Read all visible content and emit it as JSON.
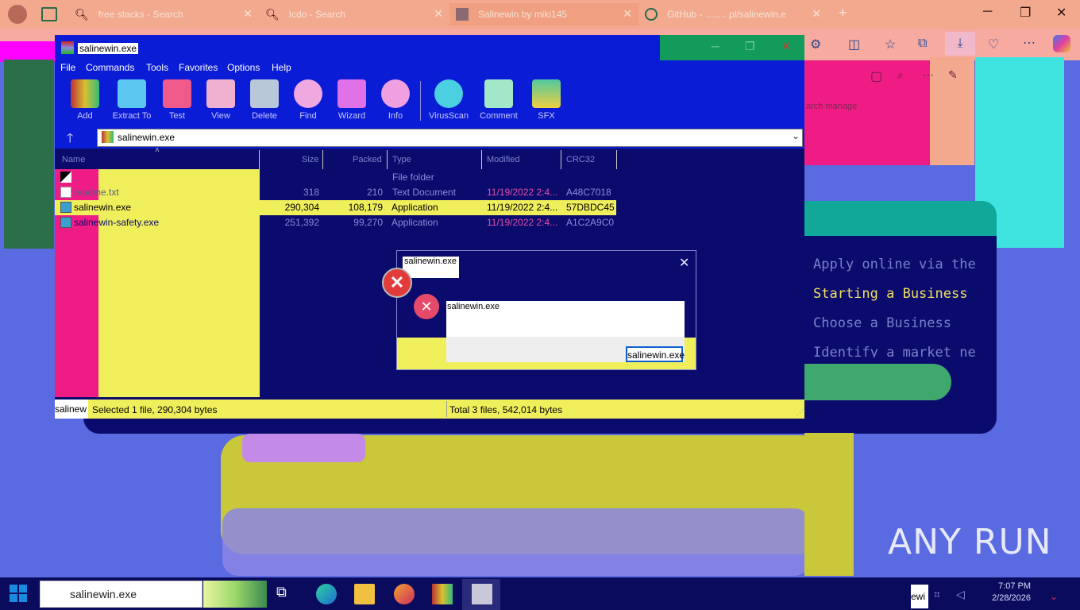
{
  "browser": {
    "tabs": [
      {
        "label": "free stacks - Search"
      },
      {
        "label": "Icdo - Search"
      },
      {
        "label": "Salinewin by miki145"
      },
      {
        "label": "GitHub - ........ pl/salinewin.e"
      }
    ]
  },
  "winrar": {
    "title": "salinewin.exe",
    "menu": [
      "File",
      "Commands",
      "Tools",
      "Favorites",
      "Options",
      "Help"
    ],
    "toolbar": [
      "Add",
      "Extract To",
      "Test",
      "View",
      "Delete",
      "Find",
      "Wizard",
      "Info",
      "VirusScan",
      "Comment",
      "SFX"
    ],
    "path": "salinewin.exe",
    "columns": [
      "Name",
      "Size",
      "Packed",
      "Type",
      "Modified",
      "CRC32"
    ],
    "files": [
      {
        "name": "..",
        "size": "",
        "packed": "",
        "type": "File folder",
        "modified": "",
        "crc": ""
      },
      {
        "name": "readme.txt",
        "size": "318",
        "packed": "210",
        "type": "Text Document",
        "modified": "11/19/2022 2:4...",
        "crc": "A48C7018"
      },
      {
        "name": "salinewin.exe",
        "size": "290,304",
        "packed": "108,179",
        "type": "Application",
        "modified": "11/19/2022 2:4...",
        "crc": "57DBDC45"
      },
      {
        "name": "salinewin-safety.exe",
        "size": "251,392",
        "packed": "99,270",
        "type": "Application",
        "modified": "11/19/2022 2:4...",
        "crc": "A1C2A9C0"
      }
    ],
    "status": {
      "left": "salinew",
      "selected": "Selected 1 file, 290,304 bytes",
      "total": "Total 3 files, 542,014 bytes"
    }
  },
  "dialog": {
    "title": "salinewin.exe",
    "message": "salinewin.exe",
    "ok_label": "salinewin.exe"
  },
  "webpage": {
    "snippet": "arch manage",
    "lines": [
      "Apply online via the",
      "Starting a Business",
      "Choose a Business",
      "Identify a market ne"
    ]
  },
  "watermark": "ANY RUN",
  "taskbar": {
    "search_text": "salinewin.exe",
    "tray_label": "ewi",
    "time": "7:07 PM",
    "date": "2/28/2026"
  }
}
